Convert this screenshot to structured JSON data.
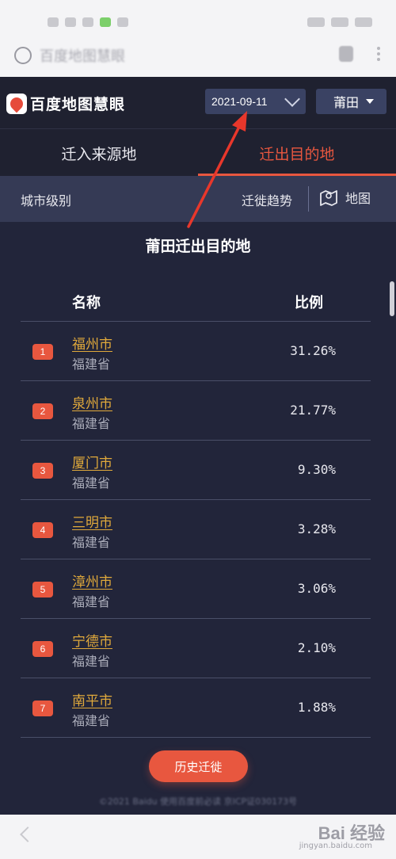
{
  "browser": {
    "url_text": "百度地图慧眼"
  },
  "app": {
    "brand_name": "百度地图慧眼",
    "date_value": "2021-09-11",
    "city_value": "莆田"
  },
  "tabs": [
    {
      "label": "迁入来源地",
      "active": false
    },
    {
      "label": "迁出目的地",
      "active": true
    }
  ],
  "toolbar": {
    "city_level_label": "城市级别",
    "trend_label": "迁徙趋势",
    "map_label": "地图"
  },
  "content": {
    "section_title": "莆田迁出目的地",
    "col_name": "名称",
    "col_ratio": "比例",
    "rows": [
      {
        "rank": "1",
        "city": "福州市",
        "province": "福建省",
        "ratio": "31.26%"
      },
      {
        "rank": "2",
        "city": "泉州市",
        "province": "福建省",
        "ratio": "21.77%"
      },
      {
        "rank": "3",
        "city": "厦门市",
        "province": "福建省",
        "ratio": "9.30%"
      },
      {
        "rank": "4",
        "city": "三明市",
        "province": "福建省",
        "ratio": "3.28%"
      },
      {
        "rank": "5",
        "city": "漳州市",
        "province": "福建省",
        "ratio": "3.06%"
      },
      {
        "rank": "6",
        "city": "宁德市",
        "province": "福建省",
        "ratio": "2.10%"
      },
      {
        "rank": "7",
        "city": "南平市",
        "province": "福建省",
        "ratio": "1.88%"
      }
    ],
    "history_button": "历史迁徙",
    "footer": "©2021 Baidu 使用百度前必读 京ICP证030173号"
  },
  "watermark": {
    "text": "Bai 经验",
    "sub": "jingyan.baidu.com"
  },
  "colors": {
    "accent": "#e8573f",
    "link": "#e0a93b",
    "background": "#22253a",
    "toolbar": "#353a55",
    "select": "#3a4263"
  }
}
